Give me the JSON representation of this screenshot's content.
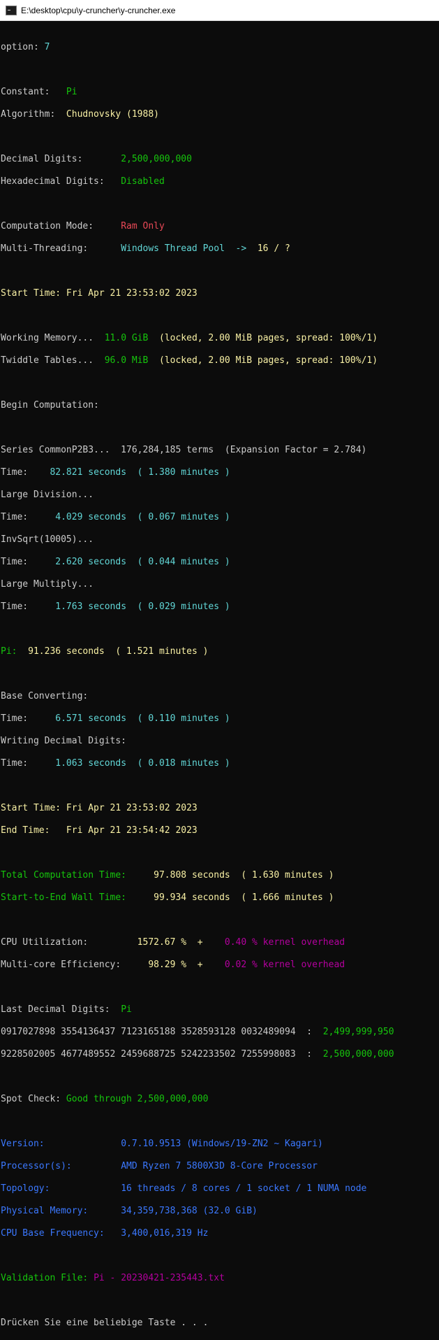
{
  "window": {
    "title": "E:\\desktop\\cpu\\y-cruncher\\y-cruncher.exe"
  },
  "console": {
    "option_label": "option: ",
    "option_value": "7",
    "constant_label": "Constant:   ",
    "constant_value": "Pi",
    "algorithm_label": "Algorithm:  ",
    "algorithm_value": "Chudnovsky (1988)",
    "decimal_digits_label": "Decimal Digits:       ",
    "decimal_digits_value": "2,500,000,000",
    "hex_digits_label": "Hexadecimal Digits:   ",
    "hex_digits_value": "Disabled",
    "computation_mode_label": "Computation Mode:     ",
    "computation_mode_value": "Ram Only",
    "multithreading_label": "Multi-Threading:      ",
    "multithreading_value": "Windows Thread Pool  ->  ",
    "multithreading_threads": "16 / ?",
    "start_time_1": "Start Time: Fri Apr 21 23:53:02 2023",
    "working_memory_label": "Working Memory...  ",
    "working_memory_value": "11.0 GiB",
    "working_memory_detail": "  (locked, 2.00 MiB pages, spread: 100%/1)",
    "twiddle_label": "Twiddle Tables...  ",
    "twiddle_value": "96.0 MiB",
    "twiddle_detail": "  (locked, 2.00 MiB pages, spread: 100%/1)",
    "begin": "Begin Computation:",
    "series_line": "Series CommonP2B3...  176,284,185 terms  (Expansion Factor = 2.784)",
    "time_label": "Time:    ",
    "series_time": "82.821 seconds  ( 1.380 minutes )",
    "large_division": "Large Division...",
    "division_time": " 4.029 seconds  ( 0.067 minutes )",
    "invsqrt": "InvSqrt(10005)...",
    "invsqrt_time": " 2.620 seconds  ( 0.044 minutes )",
    "large_multiply": "Large Multiply...",
    "multiply_time": " 1.763 seconds  ( 0.029 minutes )",
    "pi_label": "Pi:  ",
    "pi_time": "91.236 seconds  ( 1.521 minutes )",
    "base_converting": "Base Converting:",
    "convert_time": " 6.571 seconds  ( 0.110 minutes )",
    "writing_digits": "Writing Decimal Digits:",
    "writing_time": " 1.063 seconds  ( 0.018 minutes )",
    "start_time_2": "Start Time: Fri Apr 21 23:53:02 2023",
    "end_time": "End Time:   Fri Apr 21 23:54:42 2023",
    "total_time_label": "Total Computation Time:     ",
    "total_time_value": "97.808 seconds  ( 1.630 minutes )",
    "wall_time_label": "Start-to-End Wall Time:     ",
    "wall_time_value": "99.934 seconds  ( 1.666 minutes )",
    "cpu_util_label": "CPU Utilization:         ",
    "cpu_util_value": "1572.67 %  +    ",
    "cpu_util_kernel": "0.40 % kernel overhead",
    "multicore_label": "Multi-core Efficiency:     ",
    "multicore_value": "98.29 %  +    ",
    "multicore_kernel": "0.02 % kernel overhead",
    "last_digits_label": "Last Decimal Digits:  ",
    "last_digits_value": "Pi",
    "digits_row1": "0917027898 3554136437 7123165188 3528593128 0032489094  :  ",
    "digits_row1_pos": "2,499,999,950",
    "digits_row2": "9228502005 4677489552 2459688725 5242233502 7255998083  :  ",
    "digits_row2_pos": "2,500,000,000",
    "spot_check_label": "Spot Check: ",
    "spot_check_value": "Good through 2,500,000,000",
    "version_label": "Version:              ",
    "version_value": "0.7.10.9513 (Windows/19-ZN2 ~ Kagari)",
    "processor_label": "Processor(s):         ",
    "processor_value": "AMD Ryzen 7 5800X3D 8-Core Processor",
    "topology_label": "Topology:             ",
    "topology_value": "16 threads / 8 cores / 1 socket / 1 NUMA node",
    "physmem_label": "Physical Memory:      ",
    "physmem_value": "34,359,738,368 (32.0 GiB)",
    "cpu_freq_label": "CPU Base Frequency:   ",
    "cpu_freq_value": "3,400,016,319 Hz",
    "validation_label": "Validation File: ",
    "validation_value": "Pi - 20230421-235443.txt",
    "prompt": "Drücken Sie eine beliebige Taste . . ."
  }
}
